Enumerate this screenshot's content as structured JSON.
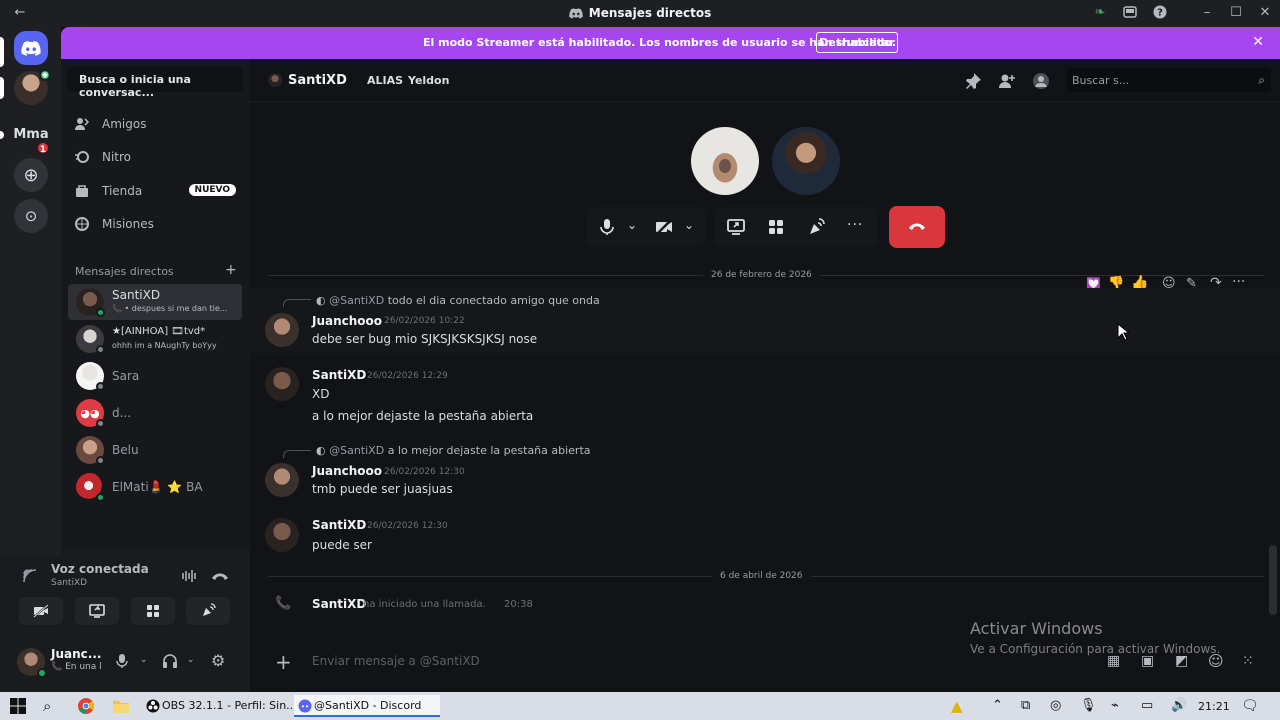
{
  "window": {
    "title": "Mensajes directos"
  },
  "rail": {
    "mma_label": "Mma",
    "mma_badge": "1"
  },
  "banner": {
    "message": "El modo Streamer está habilitado. Los nombres de usuario se han truncado.",
    "button": "Deshabilitar"
  },
  "sidebar": {
    "search_placeholder": "Busca o inicia una conversac...",
    "nav": [
      {
        "label": "Amigos"
      },
      {
        "label": "Nitro"
      },
      {
        "label": "Tienda",
        "badge": "NUEVO"
      },
      {
        "label": "Misiones"
      }
    ],
    "dm_header": "Mensajes directos",
    "dms": [
      {
        "name": "SantiXD",
        "status": "despues si me dan tie..."
      },
      {
        "name": "★[AINHOA] 🎞tvd*",
        "status": "ohhh im a NAughTy boYyy"
      },
      {
        "name": "Sara"
      },
      {
        "name": "d..."
      },
      {
        "name": "Belu"
      },
      {
        "name": "ElMati💄 ⭐ BA"
      }
    ]
  },
  "voice": {
    "title": "Voz conectada",
    "channel": "SantiXD"
  },
  "user": {
    "name": "Juanc...",
    "status": "En una l"
  },
  "chat": {
    "recipient": "SantiXD",
    "alias_label": "ALIAS",
    "alias_value": "Yeldon",
    "search_placeholder": "Buscar s...",
    "date1": "26 de febrero de 2026",
    "date2": "6 de abril de 2026",
    "messages": [
      {
        "reply_at": "@SantiXD",
        "reply_text": "todo el dia conectado amigo que onda",
        "author": "Juanchooo",
        "time": "26/02/2026 10:22",
        "text": "debe ser bug mio SJKSJKSKSJKSJ nose"
      },
      {
        "author": "SantiXD",
        "time": "26/02/2026 12:29",
        "lines": [
          "XD",
          "a lo mejor dejaste la pestaña abierta"
        ]
      },
      {
        "reply_at": "@SantiXD",
        "reply_text": "a lo mejor dejaste la pestaña abierta",
        "author": "Juanchooo",
        "time": "26/02/2026 12:30",
        "text": "tmb puede ser juasjuas"
      },
      {
        "author": "SantiXD",
        "time": "26/02/2026 12:30",
        "text": "puede ser"
      }
    ],
    "call_event": {
      "author": "SantiXD",
      "text": "ha iniciado una llamada.",
      "time": "20:38"
    },
    "composer_placeholder": "Enviar mensaje a @SantiXD"
  },
  "watermark": {
    "line1": "Activar Windows",
    "line2": "Ve a Configuración para activar Windows."
  },
  "taskbar": {
    "tasks": [
      {
        "label": "OBS 32.1.1 - Perfil: Sin..."
      },
      {
        "label": "@SantiXD - Discord"
      }
    ],
    "clock": "21:21"
  },
  "colors": {
    "accent": "#5865f2",
    "banner": "#a646f0",
    "hangup": "#da373c",
    "online": "#23a55a"
  }
}
